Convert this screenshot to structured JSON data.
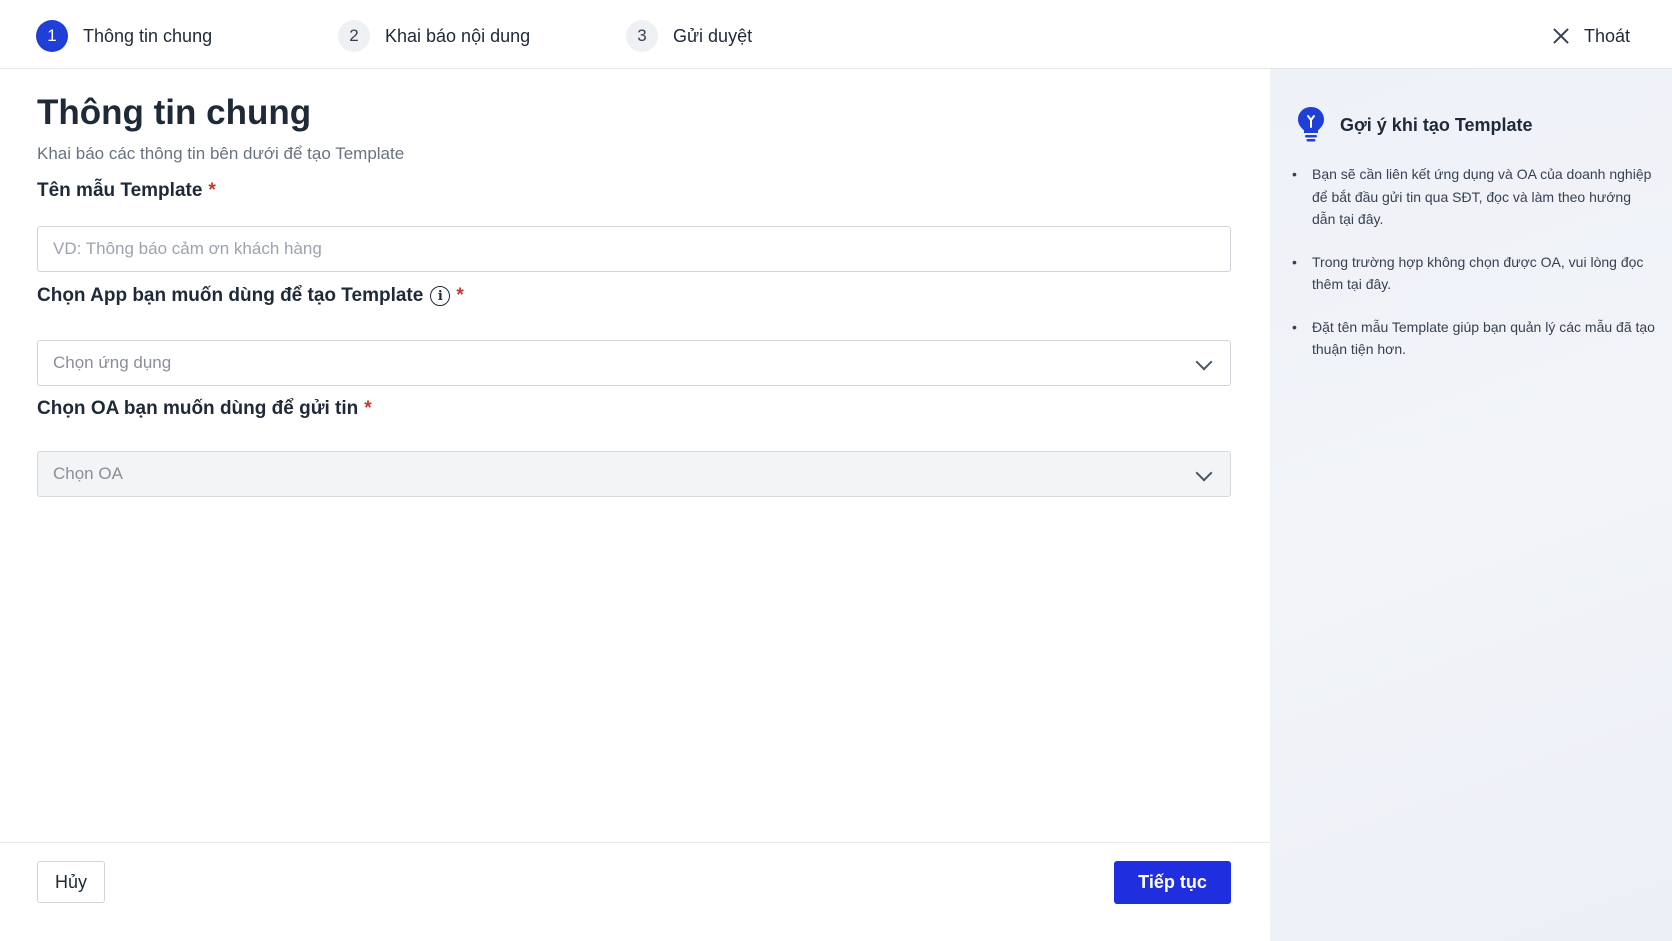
{
  "stepper": {
    "steps": [
      {
        "number": "1",
        "label": "Thông tin chung",
        "active": true
      },
      {
        "number": "2",
        "label": "Khai báo nội dung",
        "active": false
      },
      {
        "number": "3",
        "label": "Gửi duyệt",
        "active": false
      }
    ],
    "exit_label": "Thoát"
  },
  "form": {
    "title": "Thông tin chung",
    "subtitle": "Khai báo các thông tin bên dưới để tạo Template",
    "template_name": {
      "label": "Tên mẫu Template",
      "required_mark": "*",
      "placeholder": "VD: Thông báo cảm ơn khách hàng",
      "value": ""
    },
    "app_select": {
      "label": "Chọn App bạn muốn dùng để tạo Template",
      "info_glyph": "i",
      "required_mark": "*",
      "placeholder": "Chọn ứng dụng"
    },
    "oa_select": {
      "label": "Chọn OA bạn muốn dùng để gửi tin",
      "required_mark": "*",
      "placeholder": "Chọn OA"
    }
  },
  "footer": {
    "cancel_label": "Hủy",
    "next_label": "Tiếp tục"
  },
  "tips": {
    "title": "Gợi ý khi tạo Template",
    "items": [
      "Bạn sẽ cần liên kết ứng dụng và OA của doanh nghiệp để bắt đầu gửi tin qua SĐT, đọc và làm theo hướng dẫn tại đây.",
      "Trong trường hợp không chọn được OA, vui lòng đọc thêm tại đây.",
      "Đặt tên mẫu Template giúp bạn quản lý các mẫu đã tạo thuận tiện hơn."
    ]
  },
  "colors": {
    "primary": "#1f2fe0",
    "active_step": "#1f3fd6",
    "required": "#c0392b",
    "tips_bg": "#eef1f8"
  }
}
